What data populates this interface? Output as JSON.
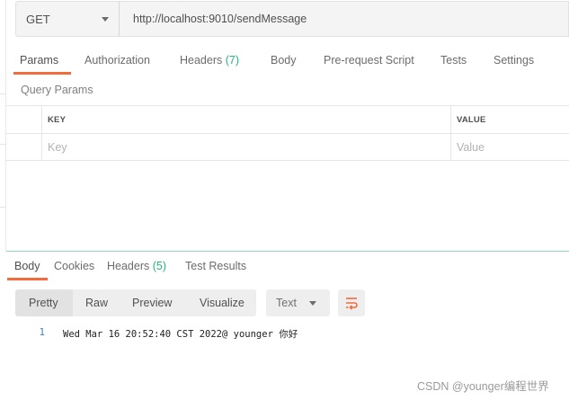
{
  "request": {
    "method": "GET",
    "url": "http://localhost:9010/sendMessage"
  },
  "request_tabs": [
    {
      "label": "Params",
      "active": true
    },
    {
      "label": "Authorization"
    },
    {
      "label": "Headers",
      "count": "(7)"
    },
    {
      "label": "Body"
    },
    {
      "label": "Pre-request Script"
    },
    {
      "label": "Tests"
    },
    {
      "label": "Settings"
    }
  ],
  "query_params": {
    "title": "Query Params",
    "headers": {
      "key": "KEY",
      "value": "VALUE"
    },
    "placeholders": {
      "key": "Key",
      "value": "Value"
    }
  },
  "response_tabs": [
    {
      "label": "Body",
      "active": true
    },
    {
      "label": "Cookies"
    },
    {
      "label": "Headers",
      "count": "(5)"
    },
    {
      "label": "Test Results"
    }
  ],
  "response_toolbar": {
    "views": [
      "Pretty",
      "Raw",
      "Preview",
      "Visualize"
    ],
    "selected_view": "Pretty",
    "format": "Text",
    "wrap_icon": "wrap-lines-icon"
  },
  "response_body": {
    "lines": [
      {
        "number": "1",
        "text": "Wed Mar 16 20:52:40 CST 2022@ younger 你好"
      }
    ]
  },
  "watermark": "CSDN @younger编程世界",
  "colors": {
    "accent": "#f26b3a",
    "count": "#26b47f",
    "divider": "#8fd6c4",
    "line_number": "#3b7fc4"
  }
}
